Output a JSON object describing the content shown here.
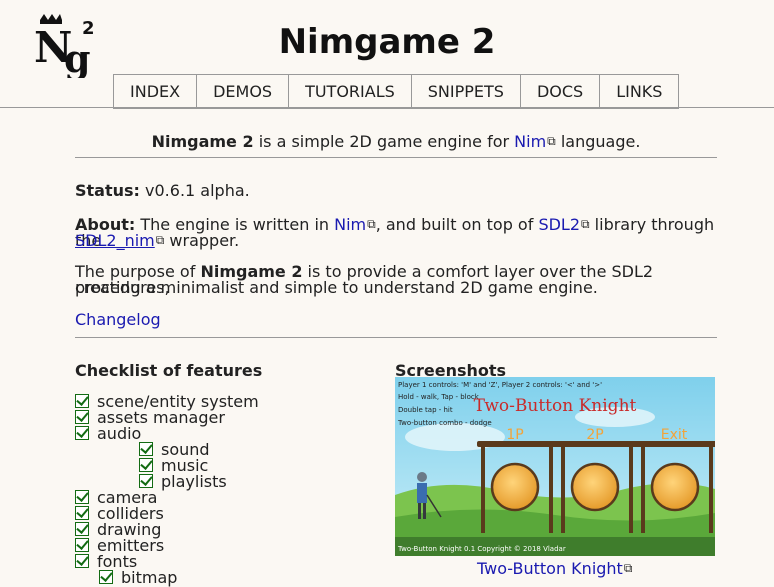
{
  "header": {
    "title": "Nimgame 2",
    "logo_text": "Ng²"
  },
  "nav": [
    {
      "label": "INDEX"
    },
    {
      "label": "DEMOS"
    },
    {
      "label": "TUTORIALS"
    },
    {
      "label": "SNIPPETS"
    },
    {
      "label": "DOCS"
    },
    {
      "label": "LINKS"
    }
  ],
  "intro": {
    "bold": "Nimgame 2",
    "text1": " is a simple 2D game engine for ",
    "link": "Nim",
    "text2": " language."
  },
  "status": {
    "label": "Status:",
    "value": " v0.6.1 alpha."
  },
  "about": {
    "label": "About:",
    "text1": " The engine is written in ",
    "link1": "Nim",
    "text2": ", and built on top of ",
    "link2": "SDL2",
    "text3": " library through the",
    "link3": "SDL2_nim",
    "text4": " wrapper."
  },
  "purpose": {
    "text1": "The purpose of ",
    "bold": "Nimgame 2",
    "text2": " is to provide a comfort layer over the SDL2 procedures,",
    "line2": "creating a minimalist and simple to understand 2D game engine."
  },
  "changelog": "Changelog",
  "checklist": {
    "heading": "Checklist of features",
    "items": [
      {
        "label": "scene/entity system"
      },
      {
        "label": "assets manager"
      },
      {
        "label": "audio"
      },
      {
        "label": "sound"
      },
      {
        "label": "music"
      },
      {
        "label": "playlists"
      },
      {
        "label": "camera"
      },
      {
        "label": "colliders"
      },
      {
        "label": "drawing"
      },
      {
        "label": "emitters"
      },
      {
        "label": "fonts"
      },
      {
        "label": "bitmap"
      }
    ]
  },
  "screenshots": {
    "heading": "Screenshots",
    "caption": "Two-Button Knight",
    "game": {
      "line1": "Player 1 controls: 'M' and 'Z', Player 2 controls: '<' and '>'",
      "line2": "Hold - walk, Tap - block",
      "line3": "Double tap - hit",
      "line4": "Two-button combo - dodge",
      "title": "Two-Button Knight",
      "opt1": "1P",
      "opt2": "2P",
      "opt3": "Exit",
      "footer": "Two-Button Knight 0.1 Copyright © 2018 Vladar"
    }
  },
  "colors": {
    "link": "#1a1ab0",
    "check": "#136b13",
    "background": "#fbf8f3"
  }
}
